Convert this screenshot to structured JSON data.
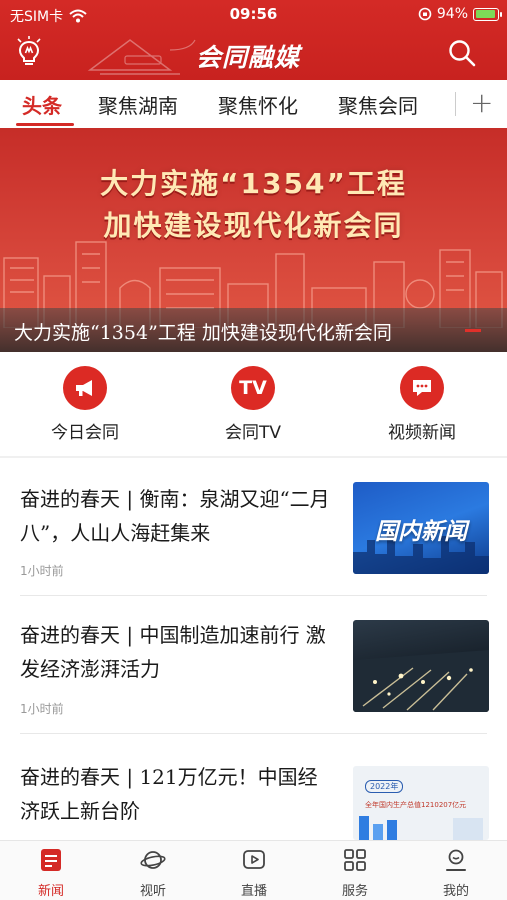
{
  "status_bar": {
    "carrier": "无SIM卡",
    "time": "09:56",
    "battery": "94%",
    "battery_level": 0.94
  },
  "header": {
    "title": "会同融媒"
  },
  "tabs": [
    {
      "label": "头条",
      "active": true
    },
    {
      "label": "聚焦湖南"
    },
    {
      "label": "聚焦怀化"
    },
    {
      "label": "聚焦会同"
    }
  ],
  "banner": {
    "line1": "大力实施“1354”工程",
    "line2": "加快建设现代化新会同",
    "caption": "大力实施“1354”工程 加快建设现代化新会同"
  },
  "quick_entries": [
    {
      "label": "今日会同",
      "icon": "megaphone-icon"
    },
    {
      "label": "会同TV",
      "icon": "tv-icon",
      "icon_text": "TV"
    },
    {
      "label": "视频新闻",
      "icon": "chat-icon"
    }
  ],
  "news": [
    {
      "title": "奋进的春天 | 衡南：泉湖又迎“二月八”，人山人海赶集来",
      "time": "1小时前",
      "thumb_text": "国内新闻"
    },
    {
      "title": "奋进的春天 | 中国制造加速前行 激发经济澎湃活力",
      "time": "1小时前"
    },
    {
      "title": "奋进的春天 | 121万亿元！中国经济跃上新台阶",
      "time": "",
      "thumb_tag": "2022年",
      "thumb_text": "全年国内生产总值1210207亿元"
    }
  ],
  "bottom_nav": [
    {
      "label": "新闻",
      "active": true,
      "icon": "news-icon"
    },
    {
      "label": "视听",
      "icon": "planet-icon"
    },
    {
      "label": "直播",
      "icon": "play-icon"
    },
    {
      "label": "服务",
      "icon": "grid-icon"
    },
    {
      "label": "我的",
      "icon": "profile-icon"
    }
  ],
  "colors": {
    "brand_red": "#d42a26",
    "banner_text": "#ffe9b5"
  }
}
